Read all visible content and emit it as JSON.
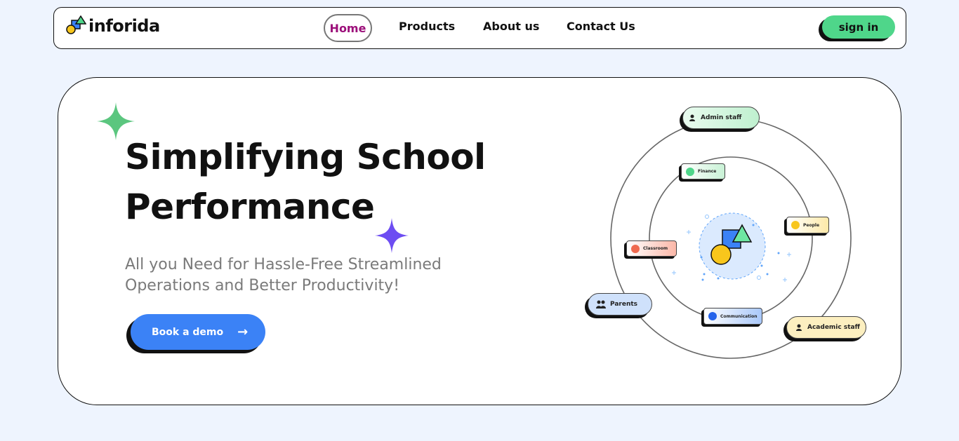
{
  "brand": {
    "name": "inforida"
  },
  "nav": {
    "home": "Home",
    "products": "Products",
    "about": "About us",
    "contact": "Contact Us",
    "signin": "sign in"
  },
  "hero": {
    "title_line1": "Simplifying School",
    "title_line2": "Performance",
    "subtitle": "All you Need for Hassle-Free Streamlined Operations and Better Productivity!",
    "cta_label": "Book a demo",
    "cta_icon": "→"
  },
  "diagram": {
    "labels": {
      "admin_staff": "Admin staff",
      "finance": "Finance",
      "people": "People",
      "classroom": "Classroom",
      "parents": "Parents",
      "communication": "Communication",
      "academic_staff": "Academic staff"
    }
  },
  "colors": {
    "background": "#eef4fe",
    "accent_green": "#4fd68a",
    "accent_blue": "#3b82f6",
    "home_text": "#9c0f7a",
    "star_purple": "#6d4df2",
    "star_green": "#5bc67f"
  }
}
